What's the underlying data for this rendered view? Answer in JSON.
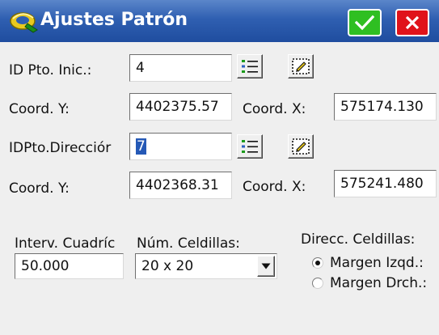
{
  "window": {
    "title": "Ajustes Patrón",
    "icon": "gold-ring-icon",
    "ok_icon": "checkmark-icon",
    "cancel_icon": "close-icon",
    "colors": {
      "titlebar": "#2f5fb1",
      "ok": "#2fbf22",
      "cancel": "#e0131a",
      "selection": "#2559b6"
    }
  },
  "start_point": {
    "id_label": "ID Pto. Inic.:",
    "id_value": "4",
    "coord_y_label": "Coord. Y:",
    "coord_y_value": "4402375.57",
    "coord_x_label": "Coord. X:",
    "coord_x_value": "575174.130",
    "list_icon": "list-icon",
    "map_icon": "map-select-icon"
  },
  "direction_point": {
    "id_label": "IDPto.Direcciór",
    "id_value": "7",
    "coord_y_label": "Coord. Y:",
    "coord_y_value": "4402368.31",
    "coord_x_label": "Coord. X:",
    "coord_x_value": "575241.480",
    "list_icon": "list-icon",
    "map_icon": "map-select-icon"
  },
  "grid": {
    "interval_label": "Interv. Cuadríc",
    "interval_value": "50.000",
    "cells_label": "Núm. Celdillas:",
    "cells_value": "20 x 20",
    "direction_label": "Direcc. Celdillas:",
    "direction_options": [
      {
        "label": "Margen Izqd.:",
        "selected": true
      },
      {
        "label": "Margen Drch.:",
        "selected": false
      }
    ]
  }
}
